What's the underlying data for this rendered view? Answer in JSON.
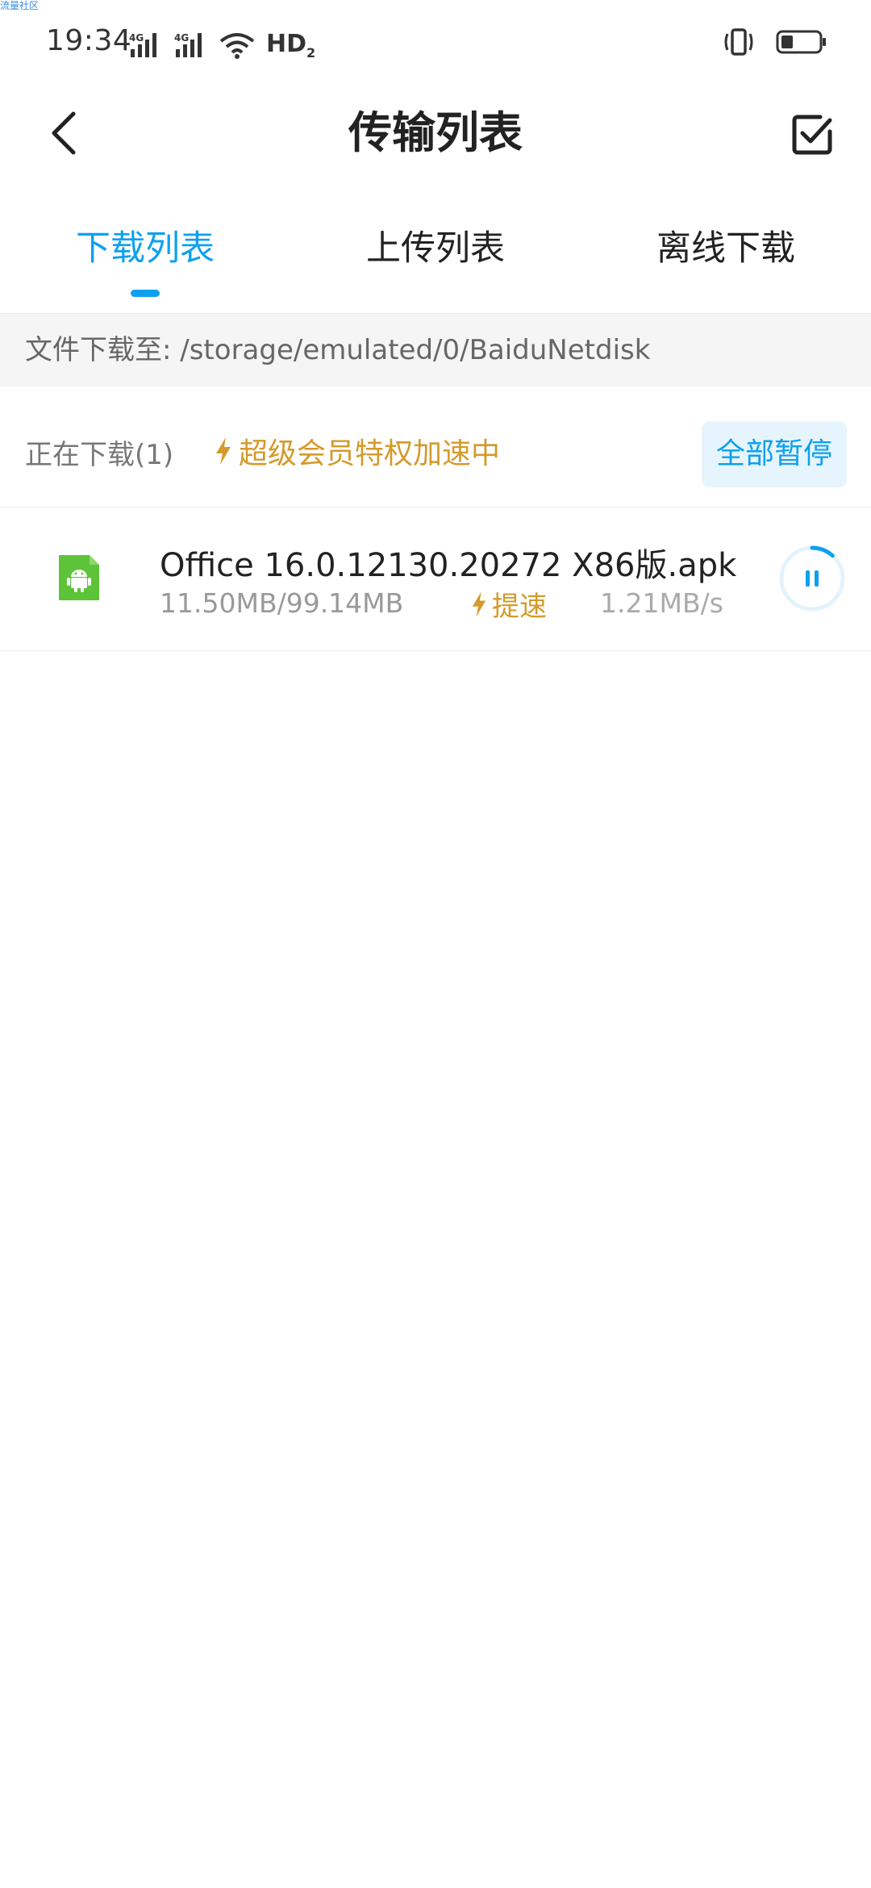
{
  "watermark": "流量社区",
  "status_bar": {
    "time": "19:34",
    "hd_label": "HD",
    "hd_sub": "2"
  },
  "header": {
    "title": "传输列表"
  },
  "tabs": [
    {
      "label": "下载列表",
      "active": true
    },
    {
      "label": "上传列表",
      "active": false
    },
    {
      "label": "离线下载",
      "active": false
    }
  ],
  "path_bar": {
    "text": "文件下载至: /storage/emulated/0/BaiduNetdisk"
  },
  "section": {
    "count_label": "正在下载(1)",
    "vip_label": "超级会员特权加速中",
    "pause_all_label": "全部暂停"
  },
  "downloads": [
    {
      "name": "Office 16.0.12130.20272 X86版.apk",
      "size": "11.50MB/99.14MB",
      "speedup_label": "提速",
      "speed": "1.21MB/s",
      "progress": 0.116,
      "icon": "android-apk-icon"
    }
  ],
  "colors": {
    "accent": "#0da0f0",
    "vip": "#d49a2b",
    "apk_green": "#5dc339"
  }
}
